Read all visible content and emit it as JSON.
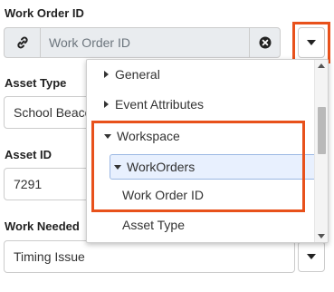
{
  "work_order": {
    "label": "Work Order ID",
    "placeholder": "Work Order ID",
    "link_icon": "link-icon",
    "clear_icon": "clear-circle-x-icon",
    "dropdown_icon": "caret-down-icon"
  },
  "asset_type": {
    "label": "Asset Type",
    "value": "School Beacon"
  },
  "asset_id": {
    "label": "Asset ID",
    "value": "7291"
  },
  "work_needed": {
    "label": "Work Needed",
    "value": "Timing Issue",
    "dropdown_icon": "caret-down-icon"
  },
  "dropdown": {
    "items": [
      {
        "label": "General",
        "state": "collapsed"
      },
      {
        "label": "Event Attributes",
        "state": "collapsed"
      },
      {
        "label": "Workspace",
        "state": "expanded"
      },
      {
        "label": "WorkOrders",
        "state": "expanded",
        "selected": true
      },
      {
        "label": "Work Order ID"
      },
      {
        "label": "Asset Type"
      }
    ]
  },
  "highlight_color": "#e8511b"
}
